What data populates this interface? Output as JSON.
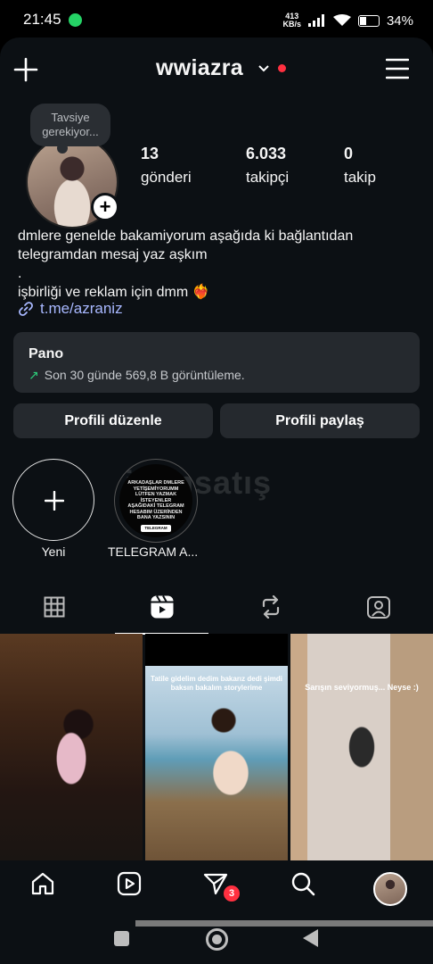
{
  "status_bar": {
    "time": "21:45",
    "speed_value": "413",
    "speed_unit": "KB/s",
    "battery": "34%"
  },
  "header": {
    "username": "wwiazra"
  },
  "profile": {
    "note": "Tavsiye gerekiyor...",
    "stats": [
      {
        "value": "13",
        "label": "gönderi"
      },
      {
        "value": "6.033",
        "label": "takipçi"
      },
      {
        "value": "0",
        "label": "takip"
      }
    ],
    "bio_lines": [
      "dmlere genelde bakamiyorum aşağıda ki bağlantıdan",
      "telegramdan mesaj yaz aşkım",
      ".",
      "işbirliği ve reklam için dmm ❤️‍🔥"
    ],
    "link": "t.me/azraniz"
  },
  "pano": {
    "title": "Pano",
    "subtitle": "Son 30 günde 569,8 B görüntüleme."
  },
  "buttons": {
    "edit": "Profili düzenle",
    "share": "Profili paylaş"
  },
  "highlights": {
    "new_label": "Yeni",
    "telegram_label": "TELEGRAM A...",
    "telegram_text": "ARKADAŞLAR DMLERE YETİŞEMİYORUMM LÜTFEN YAZMAK İSTEYENLER AŞAĞIDAKİ TELEGRAM HESABIM ÜZERİNDEN BANA YAZSININ",
    "telegram_tag": "TELEGRAM"
  },
  "watermark": "itemsatış",
  "tabs": [
    {
      "icon": "grid-icon",
      "active": false
    },
    {
      "icon": "reels-icon",
      "active": true
    },
    {
      "icon": "repost-icon",
      "active": false
    },
    {
      "icon": "tagged-icon",
      "active": false
    }
  ],
  "grid": {
    "post2_caption": "Tatile gidelim dedim bakarız dedi şimdi baksın bakalım storylerime",
    "post3_caption": "Sarışın seviyormuş... Neyse :)"
  },
  "bottom_nav": {
    "notification_count": "3"
  }
}
